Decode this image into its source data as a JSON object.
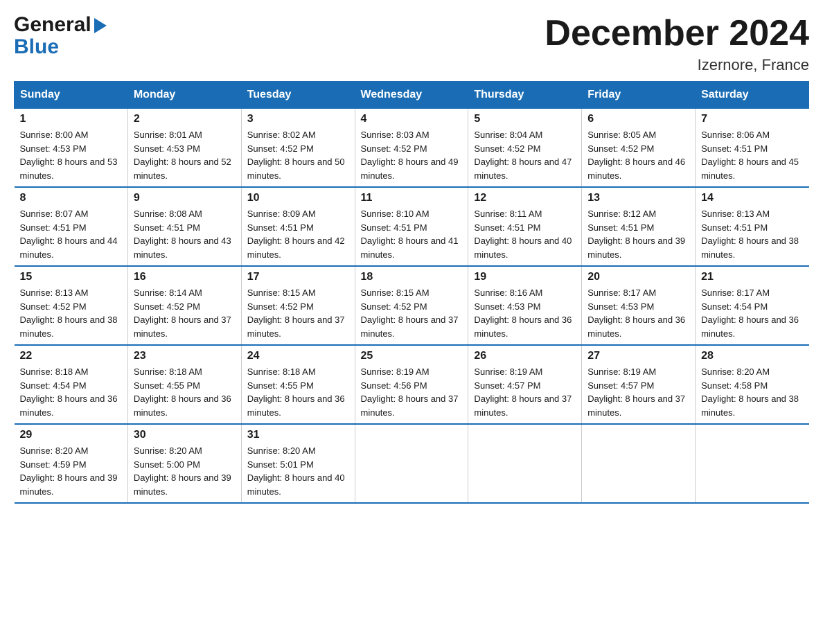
{
  "header": {
    "logo_general": "General",
    "logo_blue": "Blue",
    "month_title": "December 2024",
    "location": "Izernore, France"
  },
  "calendar": {
    "days_of_week": [
      "Sunday",
      "Monday",
      "Tuesday",
      "Wednesday",
      "Thursday",
      "Friday",
      "Saturday"
    ],
    "weeks": [
      [
        {
          "day": "1",
          "sunrise": "8:00 AM",
          "sunset": "4:53 PM",
          "daylight": "8 hours and 53 minutes."
        },
        {
          "day": "2",
          "sunrise": "8:01 AM",
          "sunset": "4:53 PM",
          "daylight": "8 hours and 52 minutes."
        },
        {
          "day": "3",
          "sunrise": "8:02 AM",
          "sunset": "4:52 PM",
          "daylight": "8 hours and 50 minutes."
        },
        {
          "day": "4",
          "sunrise": "8:03 AM",
          "sunset": "4:52 PM",
          "daylight": "8 hours and 49 minutes."
        },
        {
          "day": "5",
          "sunrise": "8:04 AM",
          "sunset": "4:52 PM",
          "daylight": "8 hours and 47 minutes."
        },
        {
          "day": "6",
          "sunrise": "8:05 AM",
          "sunset": "4:52 PM",
          "daylight": "8 hours and 46 minutes."
        },
        {
          "day": "7",
          "sunrise": "8:06 AM",
          "sunset": "4:51 PM",
          "daylight": "8 hours and 45 minutes."
        }
      ],
      [
        {
          "day": "8",
          "sunrise": "8:07 AM",
          "sunset": "4:51 PM",
          "daylight": "8 hours and 44 minutes."
        },
        {
          "day": "9",
          "sunrise": "8:08 AM",
          "sunset": "4:51 PM",
          "daylight": "8 hours and 43 minutes."
        },
        {
          "day": "10",
          "sunrise": "8:09 AM",
          "sunset": "4:51 PM",
          "daylight": "8 hours and 42 minutes."
        },
        {
          "day": "11",
          "sunrise": "8:10 AM",
          "sunset": "4:51 PM",
          "daylight": "8 hours and 41 minutes."
        },
        {
          "day": "12",
          "sunrise": "8:11 AM",
          "sunset": "4:51 PM",
          "daylight": "8 hours and 40 minutes."
        },
        {
          "day": "13",
          "sunrise": "8:12 AM",
          "sunset": "4:51 PM",
          "daylight": "8 hours and 39 minutes."
        },
        {
          "day": "14",
          "sunrise": "8:13 AM",
          "sunset": "4:51 PM",
          "daylight": "8 hours and 38 minutes."
        }
      ],
      [
        {
          "day": "15",
          "sunrise": "8:13 AM",
          "sunset": "4:52 PM",
          "daylight": "8 hours and 38 minutes."
        },
        {
          "day": "16",
          "sunrise": "8:14 AM",
          "sunset": "4:52 PM",
          "daylight": "8 hours and 37 minutes."
        },
        {
          "day": "17",
          "sunrise": "8:15 AM",
          "sunset": "4:52 PM",
          "daylight": "8 hours and 37 minutes."
        },
        {
          "day": "18",
          "sunrise": "8:15 AM",
          "sunset": "4:52 PM",
          "daylight": "8 hours and 37 minutes."
        },
        {
          "day": "19",
          "sunrise": "8:16 AM",
          "sunset": "4:53 PM",
          "daylight": "8 hours and 36 minutes."
        },
        {
          "day": "20",
          "sunrise": "8:17 AM",
          "sunset": "4:53 PM",
          "daylight": "8 hours and 36 minutes."
        },
        {
          "day": "21",
          "sunrise": "8:17 AM",
          "sunset": "4:54 PM",
          "daylight": "8 hours and 36 minutes."
        }
      ],
      [
        {
          "day": "22",
          "sunrise": "8:18 AM",
          "sunset": "4:54 PM",
          "daylight": "8 hours and 36 minutes."
        },
        {
          "day": "23",
          "sunrise": "8:18 AM",
          "sunset": "4:55 PM",
          "daylight": "8 hours and 36 minutes."
        },
        {
          "day": "24",
          "sunrise": "8:18 AM",
          "sunset": "4:55 PM",
          "daylight": "8 hours and 36 minutes."
        },
        {
          "day": "25",
          "sunrise": "8:19 AM",
          "sunset": "4:56 PM",
          "daylight": "8 hours and 37 minutes."
        },
        {
          "day": "26",
          "sunrise": "8:19 AM",
          "sunset": "4:57 PM",
          "daylight": "8 hours and 37 minutes."
        },
        {
          "day": "27",
          "sunrise": "8:19 AM",
          "sunset": "4:57 PM",
          "daylight": "8 hours and 37 minutes."
        },
        {
          "day": "28",
          "sunrise": "8:20 AM",
          "sunset": "4:58 PM",
          "daylight": "8 hours and 38 minutes."
        }
      ],
      [
        {
          "day": "29",
          "sunrise": "8:20 AM",
          "sunset": "4:59 PM",
          "daylight": "8 hours and 39 minutes."
        },
        {
          "day": "30",
          "sunrise": "8:20 AM",
          "sunset": "5:00 PM",
          "daylight": "8 hours and 39 minutes."
        },
        {
          "day": "31",
          "sunrise": "8:20 AM",
          "sunset": "5:01 PM",
          "daylight": "8 hours and 40 minutes."
        },
        null,
        null,
        null,
        null
      ]
    ]
  }
}
